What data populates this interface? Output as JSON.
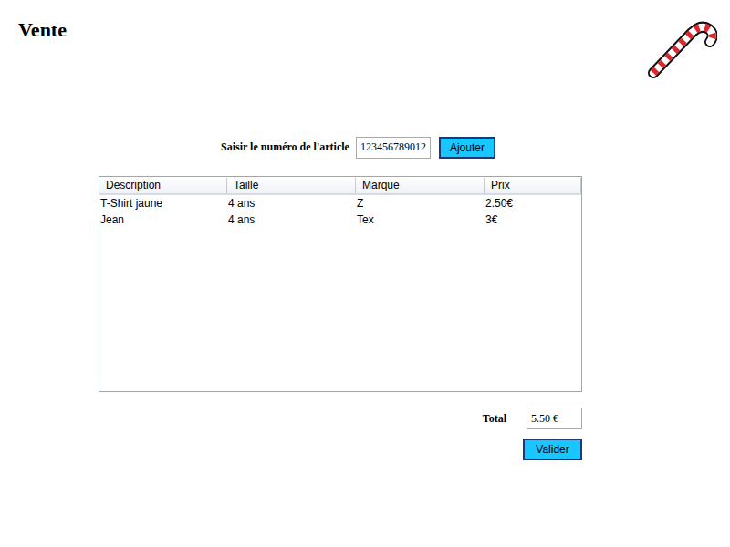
{
  "window": {
    "title": "Vente"
  },
  "search": {
    "label": "Saisir le numéro de l'article",
    "value": "123456789012",
    "button": "Ajouter"
  },
  "table": {
    "columns": [
      "Description",
      "Taille",
      "Marque",
      "Prix"
    ],
    "rows": [
      [
        "T-Shirt jaune",
        "4 ans",
        "Z",
        "2.50€"
      ],
      [
        "Jean",
        "4 ans",
        "Tex",
        "3€"
      ]
    ]
  },
  "total": {
    "label": "Total",
    "value": "5.50 €"
  },
  "buttons": [
    "Valider"
  ]
}
